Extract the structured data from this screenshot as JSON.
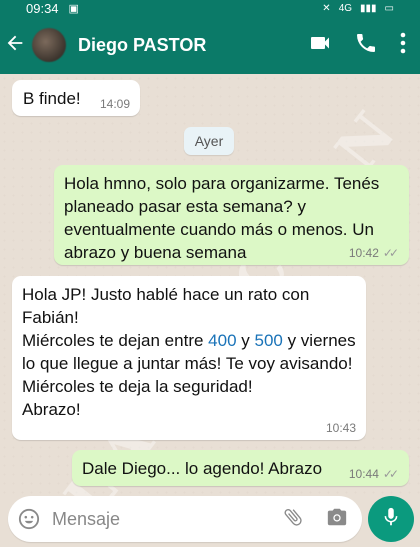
{
  "status_bar": {
    "time": "09:34",
    "signal": "4G"
  },
  "header": {
    "contact_name": "Diego PASTOR"
  },
  "watermark": "LA NACION",
  "messages": {
    "m1": {
      "text": "B finde!",
      "time": "14:09"
    },
    "date_divider": "Ayer",
    "m2": {
      "text": "Hola hmno, solo para organizarme. Tenés planeado pasar esta semana? y eventualmente cuando más o menos. Un abrazo y buena semana",
      "time": "10:42",
      "ticks": "✓✓"
    },
    "m3": {
      "line1": "Hola JP! Justo hablé hace un rato con Fabián!",
      "line2_a": "Miércoles te dejan entre ",
      "line2_num1": "400",
      "line2_b": " y ",
      "line2_num2": "500",
      "line2_c": " y viernes lo que llegue a juntar más! Te voy avisando!",
      "line3": "Miércoles te deja la seguridad!",
      "line4": "Abrazo!",
      "time": "10:43"
    },
    "m4": {
      "text": "Dale Diego... lo agendo! Abrazo",
      "time": "10:44",
      "ticks": "✓✓"
    }
  },
  "composer": {
    "placeholder": "Mensaje"
  },
  "icons": {
    "back": "arrow-left-icon",
    "video": "video-call-icon",
    "call": "phone-icon",
    "menu": "more-vert-icon",
    "emoji": "emoji-icon",
    "attach": "paperclip-icon",
    "camera": "camera-icon",
    "mic": "microphone-icon"
  },
  "colors": {
    "header": "#0b7a68",
    "outgoing": "#dcf8c6",
    "incoming": "#ffffff",
    "chat_bg": "#e8dfd5",
    "mic": "#0b9a7e"
  }
}
